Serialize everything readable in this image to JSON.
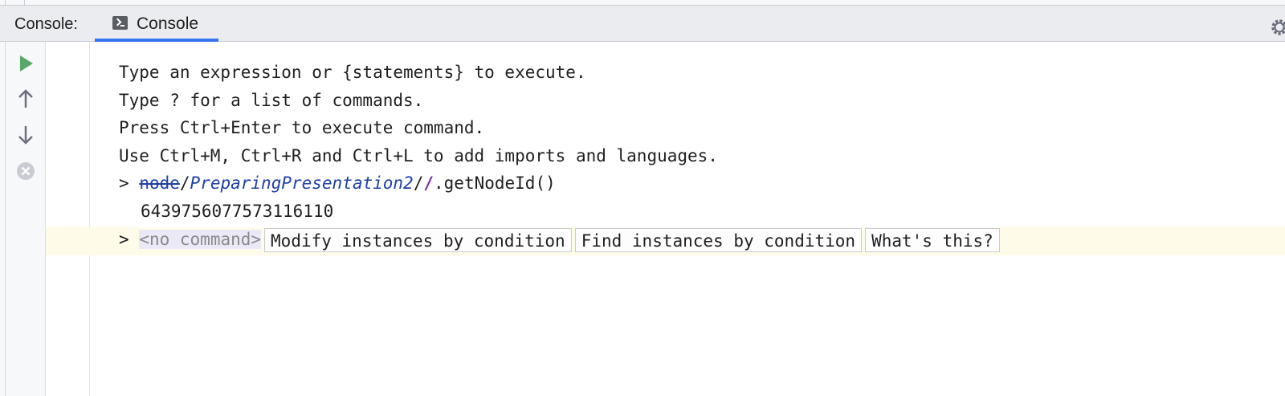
{
  "panel": {
    "label": "Console:",
    "tab_label": "Console",
    "tab_icon": "console-icon"
  },
  "toolbar": {
    "run_icon": "play-icon",
    "up_icon": "arrow-up-icon",
    "down_icon": "arrow-down-icon",
    "clear_icon": "close-circle-icon",
    "settings_icon": "gear-icon"
  },
  "console": {
    "lines": [
      "Type an expression or {statements} to execute.",
      "Type ? for a list of commands.",
      "Press Ctrl+Enter to execute command.",
      "Use Ctrl+M, Ctrl+R and Ctrl+L to add imports and languages."
    ],
    "prompt": ">",
    "command": {
      "node_ref": "node",
      "sep1": "/",
      "model_ref": "PreparingPresentation2",
      "sep2": "/",
      "sep3": "/",
      "method": ".getNodeId()"
    },
    "result": "6439756077573116110",
    "current": {
      "prompt": ">",
      "placeholder": "<no command>",
      "buttons": [
        "Modify instances by condition",
        "Find instances by condition",
        "What's this?"
      ]
    }
  },
  "colors": {
    "accent": "#3574f0",
    "run_green": "#59a869",
    "reference_blue": "#1e40a8",
    "current_line": "#fefbe8"
  }
}
